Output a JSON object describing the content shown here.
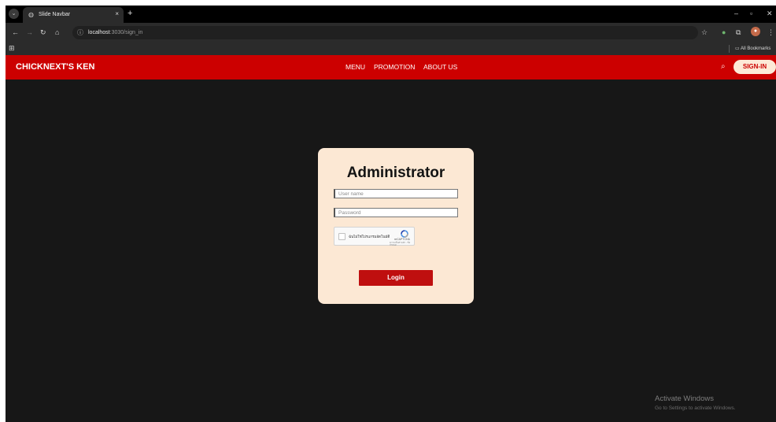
{
  "browser": {
    "tab": {
      "title": "Slide Navbar",
      "close_glyph": "×"
    },
    "new_tab_glyph": "+",
    "tab_menu_glyph": "⌄",
    "window_controls": {
      "minimize": "–",
      "restore": "▫",
      "close": "✕"
    },
    "nav": {
      "back": "←",
      "forward": "→",
      "reload": "↻",
      "home": "⌂"
    },
    "address": {
      "host": "localhost",
      "path": ":3030/sign_in"
    },
    "toolbar_icons": {
      "star": "☆",
      "extensions": "⧉",
      "menu": "⋮"
    },
    "bookmarks": {
      "apps_glyph": "⊞",
      "all_bookmarks": "All Bookmarks"
    },
    "icons": [
      "tab-menu-icon",
      "globe-icon",
      "close-icon",
      "plus-icon",
      "back-icon",
      "forward-icon",
      "reload-icon",
      "home-icon",
      "site-info-icon",
      "star-icon",
      "extension-icon",
      "profile-avatar",
      "menu-icon",
      "apps-icon",
      "folder-icon"
    ]
  },
  "site": {
    "brand": "CHICKNEXT'S KEN",
    "nav_links": [
      "MENU",
      "PROMOTION",
      "ABOUT US"
    ],
    "search_icon": "search-icon",
    "signin_label": "SIGN-IN",
    "accent_color": "#cc0000",
    "card_color": "#fce8d4"
  },
  "login": {
    "title": "Administrator",
    "username_placeholder": "User name",
    "password_placeholder": "Password",
    "captcha_label": "ฉันไม่ใช่โปรแกรมอัตโนมัติ",
    "captcha_brand": "reCAPTCHA",
    "captcha_terms": "ความเป็นส่วนตัว - ข้อกำหนด",
    "button_label": "Login"
  },
  "os": {
    "activate_title": "Activate Windows",
    "activate_sub": "Go to Settings to activate Windows."
  }
}
